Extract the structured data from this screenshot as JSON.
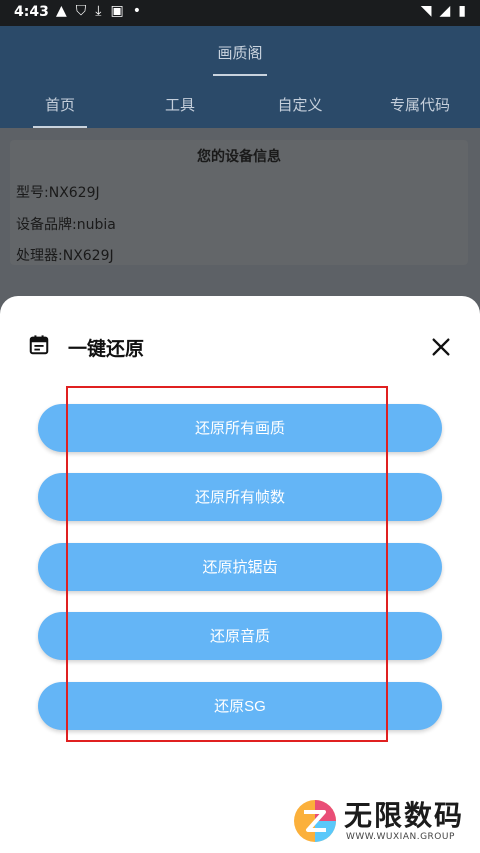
{
  "status_bar": {
    "time": "4:43",
    "icons_left": [
      "warning-icon",
      "shield-icon",
      "download-icon",
      "app-icon",
      "dot-icon"
    ],
    "icons_right": [
      "wifi-icon",
      "signal-icon",
      "battery-icon"
    ]
  },
  "app": {
    "title": "画质阁",
    "tabs": [
      {
        "label": "首页",
        "active": true
      },
      {
        "label": "工具",
        "active": false
      },
      {
        "label": "自定义",
        "active": false
      },
      {
        "label": "专属代码",
        "active": false
      }
    ]
  },
  "device_card": {
    "title": "您的设备信息",
    "model": "型号:NX629J",
    "brand": "设备品牌:nubia",
    "processor": "处理器:NX629J"
  },
  "sheet": {
    "title": "一键还原",
    "title_icon": "calendar-icon",
    "close_icon": "close-icon",
    "actions": [
      {
        "label": "还原所有画质"
      },
      {
        "label": "还原所有帧数"
      },
      {
        "label": "还原抗锯齿"
      },
      {
        "label": "还原音质"
      },
      {
        "label": "还原SG"
      }
    ]
  },
  "watermark": {
    "text": "无限数码",
    "subtext": "WWW.WUXIAN.GROUP"
  },
  "colors": {
    "action_button": "#64b5f6",
    "highlight_box": "#e02020",
    "app_bar": "#2b4a69"
  }
}
